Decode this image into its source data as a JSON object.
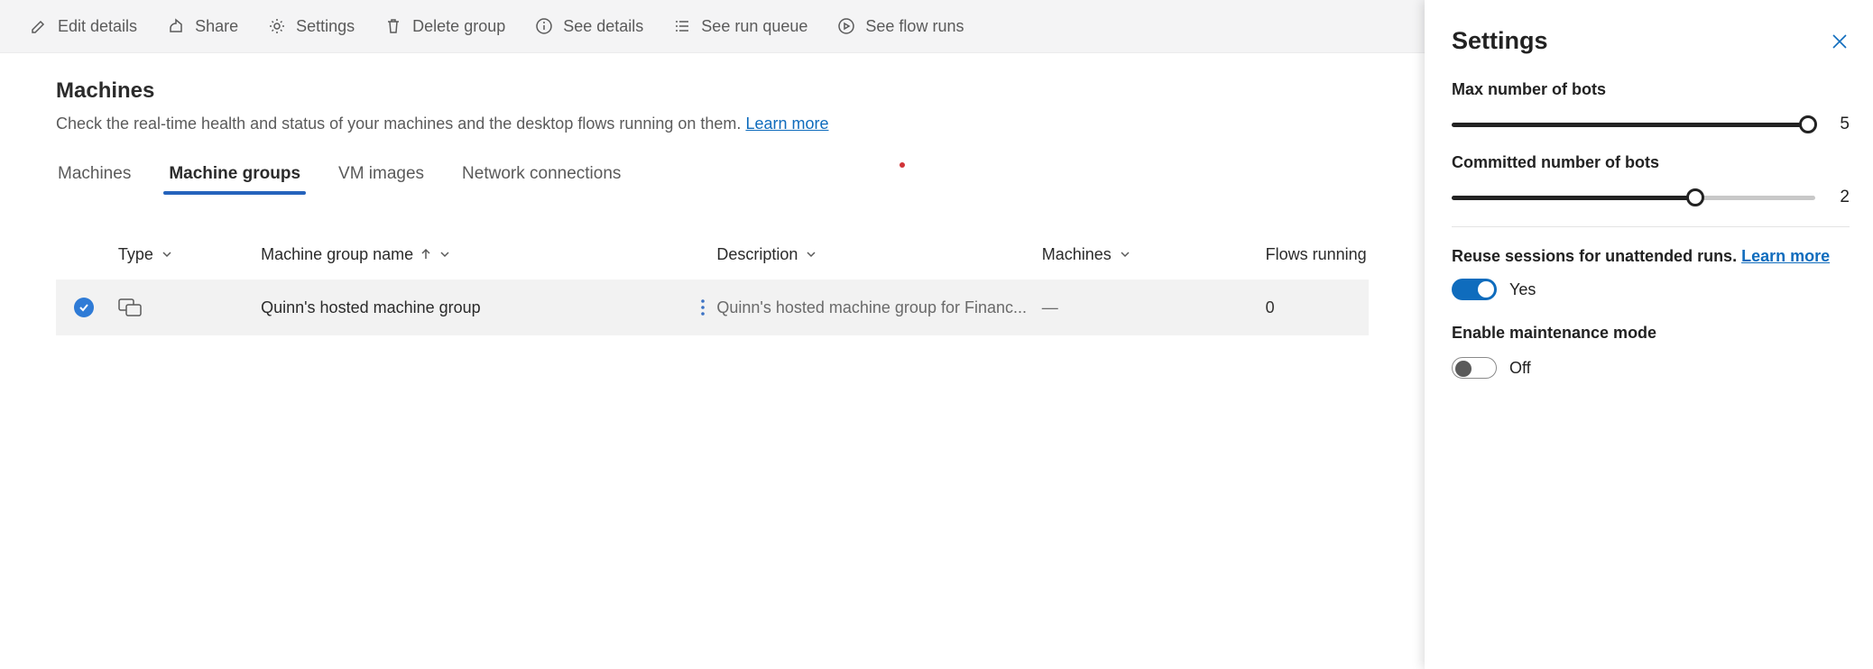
{
  "toolbar": {
    "edit": "Edit details",
    "share": "Share",
    "settings": "Settings",
    "delete": "Delete group",
    "details": "See details",
    "queue": "See run queue",
    "runs": "See flow runs"
  },
  "page": {
    "title": "Machines",
    "subtitle_a": "Check the real-time health and status of your machines and the desktop flows running on them. ",
    "subtitle_link": "Learn more"
  },
  "tabs": {
    "machines": "Machines",
    "groups": "Machine groups",
    "vm": "VM images",
    "network": "Network connections"
  },
  "table": {
    "cols": {
      "type": "Type",
      "name": "Machine group name",
      "desc": "Description",
      "machines": "Machines",
      "flows": "Flows running"
    },
    "row": {
      "name": "Quinn's hosted machine group",
      "desc": "Quinn's hosted machine group for Financ...",
      "machines": "—",
      "flows": "0"
    }
  },
  "panel": {
    "title": "Settings",
    "max_label": "Max number of bots",
    "max_value": "5",
    "committed_label": "Committed number of bots",
    "committed_value": "2",
    "reuse_text": "Reuse sessions for unattended runs. ",
    "reuse_link": "Learn more",
    "reuse_state": "Yes",
    "maintenance_label": "Enable maintenance mode",
    "maintenance_state": "Off"
  }
}
